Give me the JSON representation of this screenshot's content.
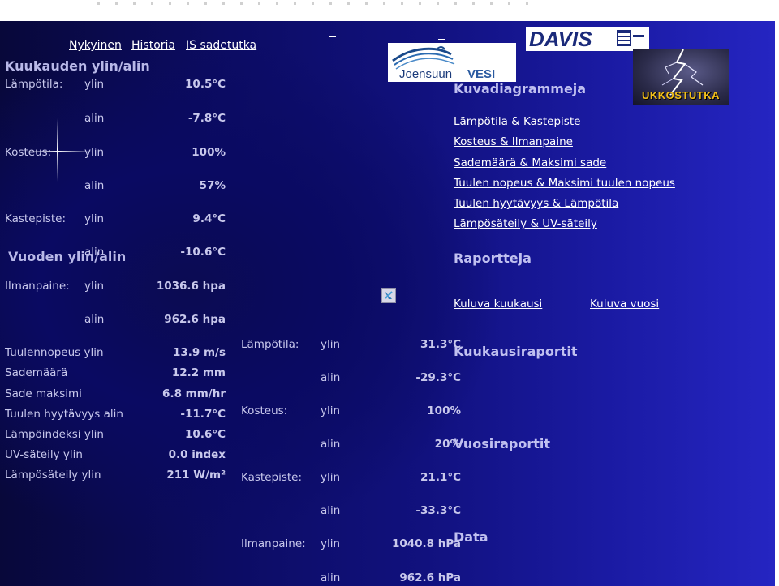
{
  "nav": {
    "current": "Nykyinen",
    "history": "Historia",
    "radar": "IS sadetutka"
  },
  "month": {
    "title": "Kuukauden ylin/alin",
    "temp_label": "Lämpötila:",
    "humidity_label": "Kosteus:",
    "dewpoint_label": "Kastepiste:",
    "high": "ylin",
    "low": "alin",
    "temp_high": "10.5°C",
    "temp_low": "-7.8°C",
    "hum_high": "100%",
    "hum_low": "57%",
    "dew_high": "9.4°C",
    "dew_low": "-10.6°C",
    "pressure_label": "Ilmanpaine:",
    "press_high": "1036.6 hpa",
    "press_low": "962.6 hpa"
  },
  "year": {
    "title": "Vuoden ylin/alin",
    "temp_label": "Lämpötila:",
    "humidity_label": "Kosteus:",
    "dewpoint_label": "Kastepiste:",
    "pressure_label": "Ilmanpaine:",
    "high": "ylin",
    "low": "alin",
    "temp_high": "31.3°C",
    "temp_low": "-29.3°C",
    "hum_high": "100%",
    "hum_low": "20%",
    "dew_high": "21.1°C",
    "dew_low": "-33.3°C",
    "press_high": "1040.8 hPa",
    "press_low": "962.6 hPa"
  },
  "extremes": [
    {
      "label": "Tuulennopeus ylin",
      "value": "13.9 m/s"
    },
    {
      "label": "Sademäärä",
      "value": "12.2 mm"
    },
    {
      "label": "Sade maksimi",
      "value": "6.8 mm/hr"
    },
    {
      "label": "Tuulen hyytävyys alin",
      "value": "-11.7°C"
    },
    {
      "label": "Lämpöindeksi ylin",
      "value": "10.6°C"
    },
    {
      "label": "UV-säteily ylin",
      "value": "0.0 index"
    },
    {
      "label": "Lämpösäteily ylin",
      "value": "211 W/m²"
    }
  ],
  "right": {
    "diagrams_title": "Kuvadiagrammeja",
    "diagram_links": [
      "Lämpötila & Kastepiste",
      "Kosteus & Ilmanpaine",
      "Sademäärä & Maksimi sade",
      "Tuulen nopeus & Maksimi tuulen nopeus",
      "Tuulen hyytävyys & Lämpötila",
      "Lämpösäteily & UV-säteily"
    ],
    "reports_title": "Raportteja",
    "current_month": "Kuluva kuukausi",
    "current_year": "Kuluva vuosi",
    "monthly_reports": "Kuukausiraportit",
    "yearly_reports": "Vuosiraportit",
    "data": "Data"
  },
  "logos": {
    "joensuu": "Joensuun VESI",
    "davis": "DAVIS",
    "ukkostutka": "UKKOSTUTKA"
  },
  "colors": {
    "text": "#c8c8ec",
    "link": "#ffffff",
    "background_dark": "#0a0a5a",
    "background_light": "#2525c2",
    "ukko_text": "#f4c018"
  }
}
